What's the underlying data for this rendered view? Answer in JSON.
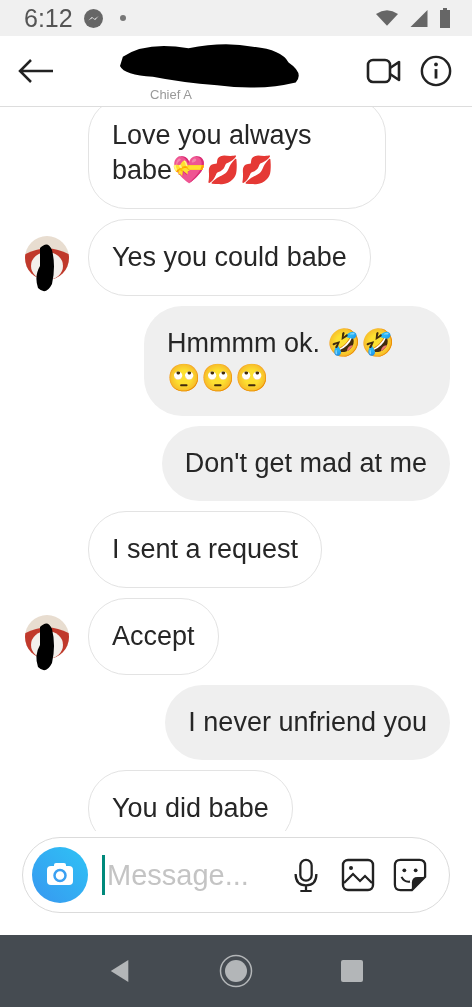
{
  "status_bar": {
    "time": "6:12"
  },
  "header": {
    "subtitle": "Chief A"
  },
  "messages": [
    {
      "kind": "received",
      "avatar": false,
      "text": "Love you always babe💝💋💋"
    },
    {
      "kind": "received",
      "avatar": true,
      "text": "Yes you could babe"
    },
    {
      "kind": "sent",
      "avatar": false,
      "text": "Hmmmm ok. 🤣🤣🙄🙄🙄"
    },
    {
      "kind": "sent",
      "avatar": false,
      "text": "Don't get mad at me"
    },
    {
      "kind": "received",
      "avatar": false,
      "text": "I sent a request"
    },
    {
      "kind": "received",
      "avatar": true,
      "text": "Accept"
    },
    {
      "kind": "sent",
      "avatar": false,
      "text": "I never unfriend you"
    },
    {
      "kind": "received",
      "avatar": false,
      "text": "You did babe"
    }
  ],
  "composer": {
    "placeholder": "Message..."
  }
}
